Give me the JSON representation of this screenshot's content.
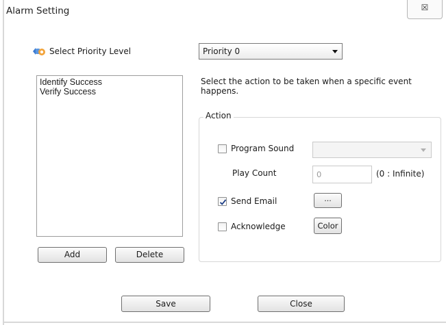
{
  "window": {
    "title": "Alarm Setting",
    "close_glyph": "☒"
  },
  "priority": {
    "label": "Select Priority Level",
    "selected": "Priority 0"
  },
  "events": {
    "items": [
      "Identify Success",
      "Verify Success"
    ]
  },
  "list_buttons": {
    "add": "Add",
    "delete": "Delete"
  },
  "instruction": "Select the action to be taken when a specific event happens.",
  "action": {
    "group_label": "Action",
    "program_sound": {
      "label": "Program Sound",
      "checked": false,
      "value": ""
    },
    "play_count": {
      "label": "Play Count",
      "value": "0",
      "hint": "(0 : Infinite)"
    },
    "send_email": {
      "label": "Send Email",
      "checked": true,
      "button": "..."
    },
    "acknowledge": {
      "label": "Acknowledge",
      "checked": false,
      "button": "Color"
    }
  },
  "footer": {
    "save": "Save",
    "close": "Close"
  }
}
